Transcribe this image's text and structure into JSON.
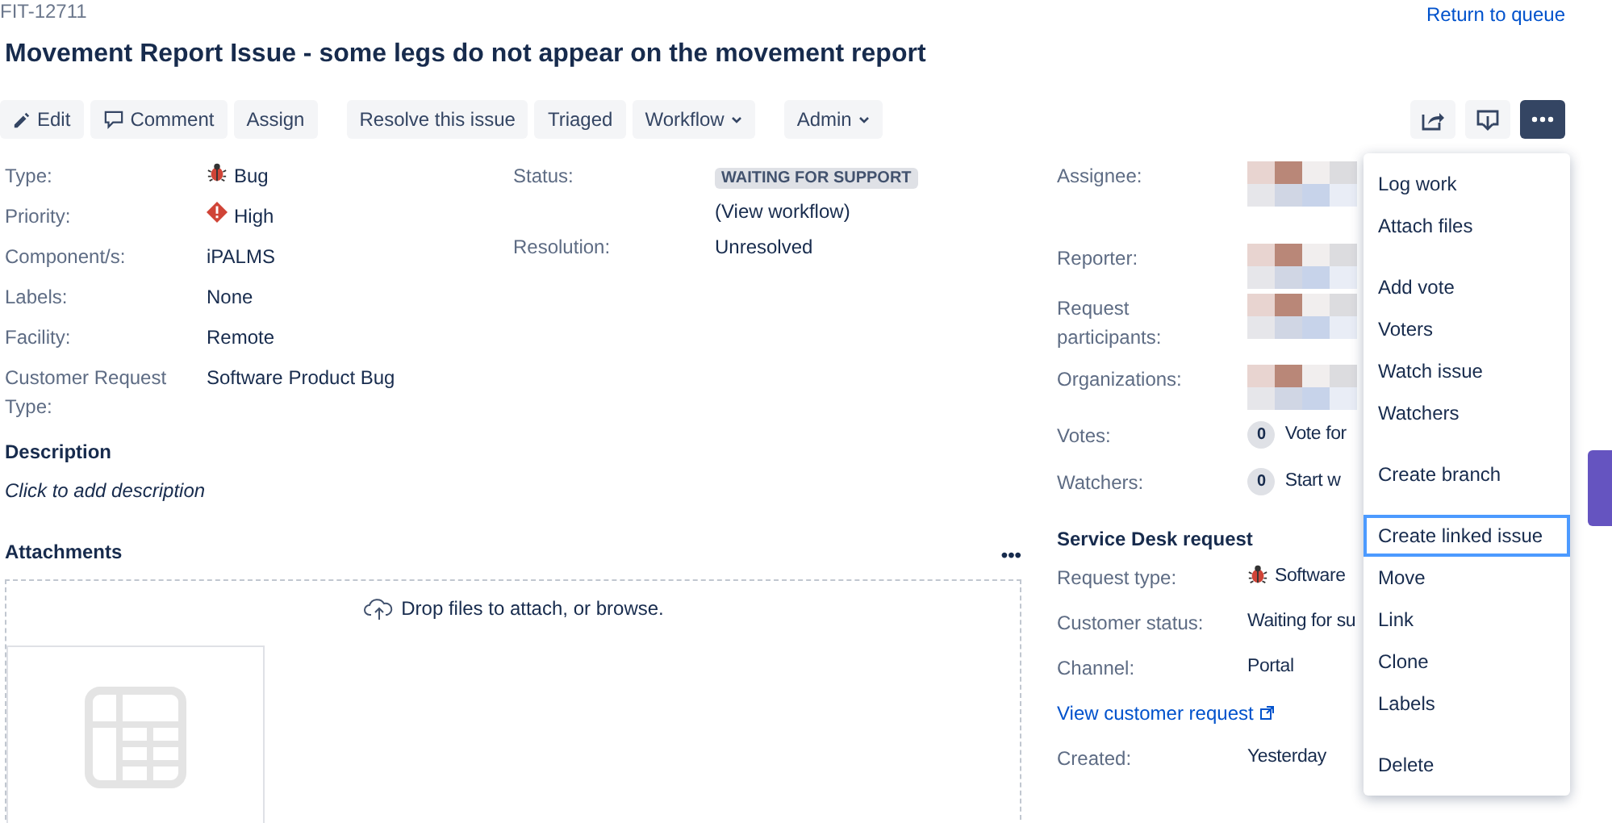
{
  "issue_key": "FIT-12711",
  "return_link": "Return to queue",
  "title": "Movement Report Issue - some legs do not appear on the movement report",
  "toolbar": [
    [
      {
        "label": "Edit"
      },
      {
        "label": "Comment"
      },
      {
        "label": "Assign"
      }
    ],
    [
      {
        "label": "Resolve this issue"
      },
      {
        "label": "Triaged"
      },
      {
        "label": "Workflow",
        "caret": true
      }
    ],
    [
      {
        "label": "Admin",
        "caret": true
      }
    ]
  ],
  "toolbar_right": [
    {
      "active": false
    },
    {
      "active": false
    },
    {
      "active": true
    }
  ],
  "details": [
    {
      "label": "Type:",
      "value": "Bug",
      "kind": "bug"
    },
    {
      "label": "Priority:",
      "value": "High",
      "kind": "priority"
    },
    {
      "label": "Component/s:",
      "value": "iPALMS",
      "kind": "link"
    },
    {
      "label": "Labels:",
      "value": "None",
      "kind": "text"
    },
    {
      "label": "Facility:",
      "value": "Remote",
      "kind": "text"
    },
    {
      "label": "Customer Request Type:",
      "value": "Software Product Bug",
      "kind": "text"
    }
  ],
  "status": {
    "label": "Status:",
    "value": "WAITING FOR SUPPORT",
    "open": "(",
    "link": "View workflow",
    "close": ")"
  },
  "resolution": {
    "label": "Resolution:",
    "value": "Unresolved"
  },
  "description": {
    "heading": "Description",
    "placeholder": "Click to add description"
  },
  "attachments": {
    "heading": "Attachments",
    "menu": "•••",
    "drop_text": "Drop files to attach, or ",
    "browse": "browse",
    "end": "."
  },
  "people": [
    {
      "label": "Assignee:",
      "kind": "redacted"
    },
    {
      "label": "Reporter:",
      "kind": "redacted"
    },
    {
      "label": "Request participants:",
      "kind": "redacted"
    },
    {
      "label": "Organizations:",
      "kind": "redacted"
    },
    {
      "label": "Votes:",
      "kind": "count",
      "count": "0",
      "link": "Vote for"
    },
    {
      "label": "Watchers:",
      "kind": "count",
      "count": "0",
      "link": "Start w"
    }
  ],
  "service_desk": {
    "heading": "Service Desk request",
    "fields": [
      {
        "label": "Request type:",
        "value": "Software",
        "kind": "bug"
      },
      {
        "label": "Customer status:",
        "value": "Waiting for su",
        "kind": "text"
      },
      {
        "label": "Channel:",
        "value": "Portal",
        "kind": "text"
      },
      {
        "value": "View customer request",
        "kind": "external-link"
      },
      {
        "label": "Created:",
        "value": "Yesterday",
        "kind": "text"
      }
    ]
  },
  "menu": [
    [
      {
        "label": "Log work",
        "selected": false
      },
      {
        "label": "Attach files",
        "selected": false
      }
    ],
    [
      {
        "label": "Add vote",
        "selected": false
      },
      {
        "label": "Voters",
        "selected": false
      },
      {
        "label": "Watch issue",
        "selected": false
      },
      {
        "label": "Watchers",
        "selected": false
      }
    ],
    [
      {
        "label": "Create branch",
        "selected": false
      }
    ],
    [
      {
        "label": "Create linked issue",
        "selected": true
      },
      {
        "label": "Move",
        "selected": false
      },
      {
        "label": "Link",
        "selected": false
      },
      {
        "label": "Clone",
        "selected": false
      },
      {
        "label": "Labels",
        "selected": false
      }
    ],
    [
      {
        "label": "Delete",
        "selected": false
      }
    ]
  ]
}
